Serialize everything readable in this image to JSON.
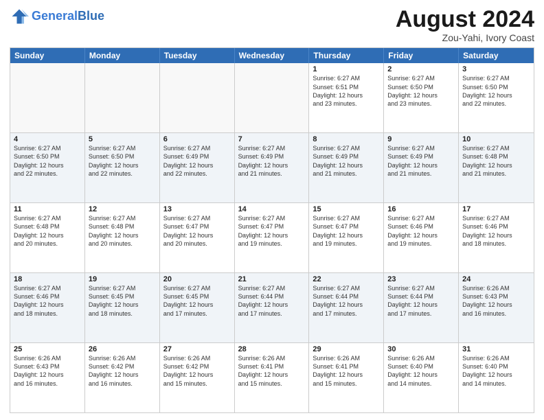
{
  "header": {
    "logo_line1": "General",
    "logo_line2": "Blue",
    "main_title": "August 2024",
    "subtitle": "Zou-Yahi, Ivory Coast"
  },
  "calendar": {
    "weekdays": [
      "Sunday",
      "Monday",
      "Tuesday",
      "Wednesday",
      "Thursday",
      "Friday",
      "Saturday"
    ],
    "rows": [
      [
        {
          "day": "",
          "info": ""
        },
        {
          "day": "",
          "info": ""
        },
        {
          "day": "",
          "info": ""
        },
        {
          "day": "",
          "info": ""
        },
        {
          "day": "1",
          "info": "Sunrise: 6:27 AM\nSunset: 6:51 PM\nDaylight: 12 hours\nand 23 minutes."
        },
        {
          "day": "2",
          "info": "Sunrise: 6:27 AM\nSunset: 6:50 PM\nDaylight: 12 hours\nand 23 minutes."
        },
        {
          "day": "3",
          "info": "Sunrise: 6:27 AM\nSunset: 6:50 PM\nDaylight: 12 hours\nand 22 minutes."
        }
      ],
      [
        {
          "day": "4",
          "info": "Sunrise: 6:27 AM\nSunset: 6:50 PM\nDaylight: 12 hours\nand 22 minutes."
        },
        {
          "day": "5",
          "info": "Sunrise: 6:27 AM\nSunset: 6:50 PM\nDaylight: 12 hours\nand 22 minutes."
        },
        {
          "day": "6",
          "info": "Sunrise: 6:27 AM\nSunset: 6:49 PM\nDaylight: 12 hours\nand 22 minutes."
        },
        {
          "day": "7",
          "info": "Sunrise: 6:27 AM\nSunset: 6:49 PM\nDaylight: 12 hours\nand 21 minutes."
        },
        {
          "day": "8",
          "info": "Sunrise: 6:27 AM\nSunset: 6:49 PM\nDaylight: 12 hours\nand 21 minutes."
        },
        {
          "day": "9",
          "info": "Sunrise: 6:27 AM\nSunset: 6:49 PM\nDaylight: 12 hours\nand 21 minutes."
        },
        {
          "day": "10",
          "info": "Sunrise: 6:27 AM\nSunset: 6:48 PM\nDaylight: 12 hours\nand 21 minutes."
        }
      ],
      [
        {
          "day": "11",
          "info": "Sunrise: 6:27 AM\nSunset: 6:48 PM\nDaylight: 12 hours\nand 20 minutes."
        },
        {
          "day": "12",
          "info": "Sunrise: 6:27 AM\nSunset: 6:48 PM\nDaylight: 12 hours\nand 20 minutes."
        },
        {
          "day": "13",
          "info": "Sunrise: 6:27 AM\nSunset: 6:47 PM\nDaylight: 12 hours\nand 20 minutes."
        },
        {
          "day": "14",
          "info": "Sunrise: 6:27 AM\nSunset: 6:47 PM\nDaylight: 12 hours\nand 19 minutes."
        },
        {
          "day": "15",
          "info": "Sunrise: 6:27 AM\nSunset: 6:47 PM\nDaylight: 12 hours\nand 19 minutes."
        },
        {
          "day": "16",
          "info": "Sunrise: 6:27 AM\nSunset: 6:46 PM\nDaylight: 12 hours\nand 19 minutes."
        },
        {
          "day": "17",
          "info": "Sunrise: 6:27 AM\nSunset: 6:46 PM\nDaylight: 12 hours\nand 18 minutes."
        }
      ],
      [
        {
          "day": "18",
          "info": "Sunrise: 6:27 AM\nSunset: 6:46 PM\nDaylight: 12 hours\nand 18 minutes."
        },
        {
          "day": "19",
          "info": "Sunrise: 6:27 AM\nSunset: 6:45 PM\nDaylight: 12 hours\nand 18 minutes."
        },
        {
          "day": "20",
          "info": "Sunrise: 6:27 AM\nSunset: 6:45 PM\nDaylight: 12 hours\nand 17 minutes."
        },
        {
          "day": "21",
          "info": "Sunrise: 6:27 AM\nSunset: 6:44 PM\nDaylight: 12 hours\nand 17 minutes."
        },
        {
          "day": "22",
          "info": "Sunrise: 6:27 AM\nSunset: 6:44 PM\nDaylight: 12 hours\nand 17 minutes."
        },
        {
          "day": "23",
          "info": "Sunrise: 6:27 AM\nSunset: 6:44 PM\nDaylight: 12 hours\nand 17 minutes."
        },
        {
          "day": "24",
          "info": "Sunrise: 6:26 AM\nSunset: 6:43 PM\nDaylight: 12 hours\nand 16 minutes."
        }
      ],
      [
        {
          "day": "25",
          "info": "Sunrise: 6:26 AM\nSunset: 6:43 PM\nDaylight: 12 hours\nand 16 minutes."
        },
        {
          "day": "26",
          "info": "Sunrise: 6:26 AM\nSunset: 6:42 PM\nDaylight: 12 hours\nand 16 minutes."
        },
        {
          "day": "27",
          "info": "Sunrise: 6:26 AM\nSunset: 6:42 PM\nDaylight: 12 hours\nand 15 minutes."
        },
        {
          "day": "28",
          "info": "Sunrise: 6:26 AM\nSunset: 6:41 PM\nDaylight: 12 hours\nand 15 minutes."
        },
        {
          "day": "29",
          "info": "Sunrise: 6:26 AM\nSunset: 6:41 PM\nDaylight: 12 hours\nand 15 minutes."
        },
        {
          "day": "30",
          "info": "Sunrise: 6:26 AM\nSunset: 6:40 PM\nDaylight: 12 hours\nand 14 minutes."
        },
        {
          "day": "31",
          "info": "Sunrise: 6:26 AM\nSunset: 6:40 PM\nDaylight: 12 hours\nand 14 minutes."
        }
      ]
    ]
  }
}
